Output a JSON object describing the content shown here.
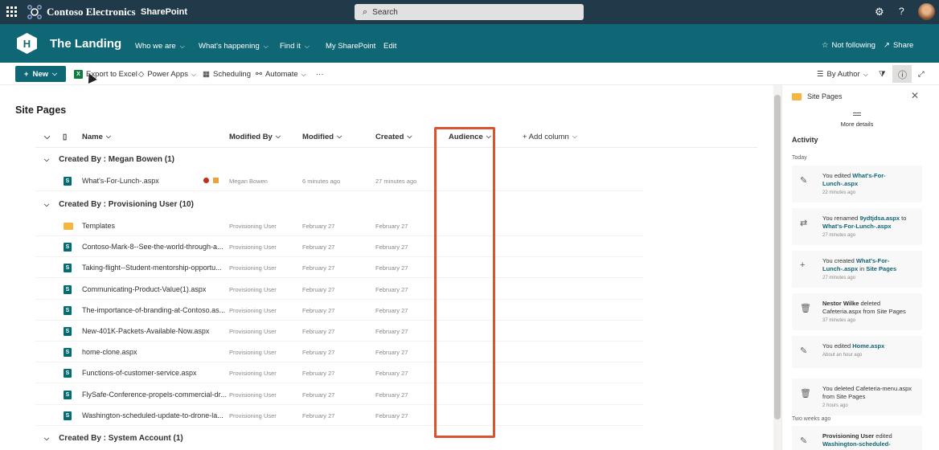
{
  "suite": {
    "brand": "Contoso Electronics",
    "app": "SharePoint",
    "search_placeholder": "Search"
  },
  "site": {
    "logo_letter": "H",
    "title": "The Landing",
    "nav": [
      "Who we are",
      "What's happening",
      "Find it",
      "My SharePoint",
      "Edit"
    ],
    "follow": "Not following",
    "share": "Share"
  },
  "commands": {
    "new": "New",
    "export": "Export to Excel",
    "power_apps": "Power Apps",
    "scheduling": "Scheduling",
    "automate": "Automate",
    "more": "···",
    "view": "By Author"
  },
  "library": {
    "title": "Site Pages",
    "columns": {
      "name": "Name",
      "modified_by": "Modified By",
      "modified": "Modified",
      "created": "Created",
      "audience": "Audience",
      "add": "+ Add column"
    },
    "groups": [
      {
        "label": "Created By : Megan Bowen (1)",
        "rows": [
          {
            "name": "What's-For-Lunch-.aspx",
            "type": "page",
            "modified_by": "Megan Bowen",
            "modified": "6 minutes ago",
            "created": "27 minutes ago"
          }
        ]
      },
      {
        "label": "Created By : Provisioning User (10)",
        "rows": [
          {
            "name": "Templates",
            "type": "folder",
            "modified_by": "Provisioning User",
            "modified": "February 27",
            "created": "February 27"
          },
          {
            "name": "Contoso-Mark-8--See-the-world-through-a...",
            "type": "page",
            "modified_by": "Provisioning User",
            "modified": "February 27",
            "created": "February 27"
          },
          {
            "name": "Taking-flight--Student-mentorship-opportu...",
            "type": "page",
            "modified_by": "Provisioning User",
            "modified": "February 27",
            "created": "February 27"
          },
          {
            "name": "Communicating-Product-Value(1).aspx",
            "type": "page",
            "modified_by": "Provisioning User",
            "modified": "February 27",
            "created": "February 27"
          },
          {
            "name": "The-importance-of-branding-at-Contoso.as...",
            "type": "page",
            "modified_by": "Provisioning User",
            "modified": "February 27",
            "created": "February 27"
          },
          {
            "name": "New-401K-Packets-Available-Now.aspx",
            "type": "page",
            "modified_by": "Provisioning User",
            "modified": "February 27",
            "created": "February 27"
          },
          {
            "name": "home-clone.aspx",
            "type": "page",
            "modified_by": "Provisioning User",
            "modified": "February 27",
            "created": "February 27"
          },
          {
            "name": "Functions-of-customer-service.aspx",
            "type": "page",
            "modified_by": "Provisioning User",
            "modified": "February 27",
            "created": "February 27"
          },
          {
            "name": "FlySafe-Conference-propels-commercial-dr...",
            "type": "page",
            "modified_by": "Provisioning User",
            "modified": "February 27",
            "created": "February 27"
          },
          {
            "name": "Washington-scheduled-update-to-drone-la...",
            "type": "page",
            "modified_by": "Provisioning User",
            "modified": "February 27",
            "created": "February 27"
          }
        ]
      },
      {
        "label": "Created By : System Account (1)",
        "rows": []
      }
    ]
  },
  "panel": {
    "title": "Site Pages",
    "more_details": "More details",
    "activity": "Activity",
    "today": "Today",
    "two_weeks": "Two weeks ago",
    "cards": [
      {
        "icon": "✎",
        "parts": [
          "You edited ",
          "What's-For-Lunch-.aspx"
        ],
        "time": "22 minutes ago"
      },
      {
        "icon": "⇄",
        "parts": [
          "You renamed ",
          "9ydtjdsa.aspx",
          " to ",
          "What's-For-Lunch-.aspx"
        ],
        "time": "27 minutes ago"
      },
      {
        "icon": "+",
        "parts": [
          "You created ",
          "What's-For-Lunch-.aspx",
          " in ",
          "Site Pages"
        ],
        "time": "27 minutes ago"
      },
      {
        "icon": "🗑",
        "parts": [
          "Nestor Wilke",
          " deleted Cafeteria.aspx from Site Pages"
        ],
        "time": "37 minutes ago"
      },
      {
        "icon": "✎",
        "parts": [
          "You edited ",
          "Home.aspx"
        ],
        "time": "About an hour ago"
      },
      {
        "icon": "🗑",
        "parts": [
          "You deleted Cafeteria-menu.aspx from Site Pages"
        ],
        "time": "2 hours ago"
      },
      {
        "icon": "✎",
        "parts": [
          "Provisioning User",
          " edited ",
          "Washington-scheduled-"
        ],
        "time": ""
      }
    ]
  }
}
